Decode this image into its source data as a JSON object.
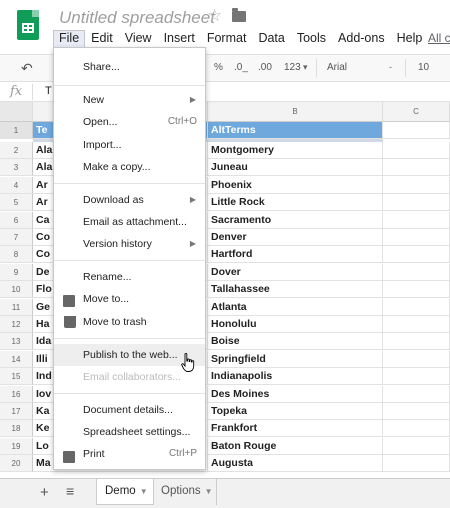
{
  "app": {
    "title": "Untitled spreadsheet"
  },
  "menubar": {
    "items": [
      "File",
      "Edit",
      "View",
      "Insert",
      "Format",
      "Data",
      "Tools",
      "Add-ons",
      "Help"
    ],
    "link": "All c"
  },
  "toolbar": {
    "percent": "%",
    "decrease_decimal": ".0_",
    "increase_decimal": ".00",
    "number_format": "123",
    "font": "Arial",
    "font_size": "10"
  },
  "formula_bar": {
    "fx_label": "fx",
    "value": "T"
  },
  "grid": {
    "columns": [
      "B",
      "C"
    ],
    "rows": [
      "1",
      "2",
      "3",
      "4",
      "5",
      "6",
      "7",
      "8",
      "9",
      "10",
      "11",
      "12",
      "13",
      "14",
      "15",
      "16",
      "17",
      "18",
      "19",
      "20"
    ],
    "col_a_partial": [
      "Te",
      "Ala",
      "Ala",
      "Ar",
      "Ar",
      "Ca",
      "Co",
      "Co",
      "De",
      "Flo",
      "Ge",
      "Ha",
      "Ida",
      "Illi",
      "Ind",
      "Iov",
      "Ka",
      "Ke",
      "Lo",
      "Ma"
    ],
    "col_b": [
      "AltTerms",
      "Montgomery",
      "Juneau",
      "Phoenix",
      "Little Rock",
      "Sacramento",
      "Denver",
      "Hartford",
      "Dover",
      "Tallahassee",
      "Atlanta",
      "Honolulu",
      "Boise",
      "Springfield",
      "Indianapolis",
      "Des Moines",
      "Topeka",
      "Frankfort",
      "Baton Rouge",
      "Augusta"
    ]
  },
  "file_menu": {
    "share": "Share...",
    "new": "New",
    "open": "Open...",
    "open_shortcut": "Ctrl+O",
    "import": "Import...",
    "make_copy": "Make a copy...",
    "download_as": "Download as",
    "email_attachment": "Email as attachment...",
    "version_history": "Version history",
    "rename": "Rename...",
    "move_to": "Move to...",
    "move_to_trash": "Move to trash",
    "publish_web": "Publish to the web...",
    "email_collaborators": "Email collaborators...",
    "document_details": "Document details...",
    "spreadsheet_settings": "Spreadsheet settings...",
    "print": "Print",
    "print_shortcut": "Ctrl+P"
  },
  "sheets": {
    "tabs": [
      "Demo",
      "Options"
    ],
    "active": "Demo"
  },
  "colors": {
    "header_fill": "#6fa8dc",
    "logo": "#0f9d58"
  }
}
